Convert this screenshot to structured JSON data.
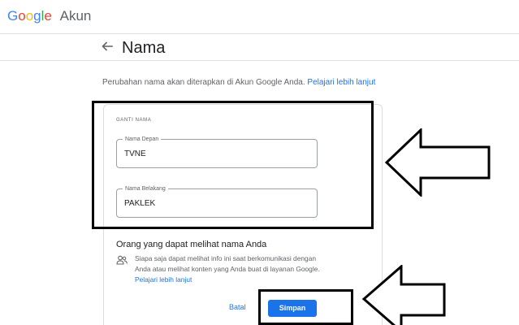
{
  "header": {
    "logo_letters": [
      "G",
      "o",
      "o",
      "g",
      "l",
      "e"
    ],
    "product": "Akun"
  },
  "title_bar": {
    "title": "Nama"
  },
  "description": {
    "text": "Perubahan nama akan diterapkan di Akun Google Anda.",
    "link": "Pelajari lebih lanjut"
  },
  "form": {
    "section_label": "GANTI NAMA",
    "first_name": {
      "label": "Nama Depan",
      "value": "TVNE"
    },
    "last_name": {
      "label": "Nama Belakang",
      "value": "PAKLEK"
    }
  },
  "visibility": {
    "title": "Orang yang dapat melihat nama Anda",
    "text": "Siapa saja dapat melihat info ini saat berkomunikasi dengan Anda atau melihat konten yang Anda buat di layanan Google.",
    "link": "Pelajari lebih lanjut"
  },
  "actions": {
    "cancel_label": "Batal",
    "save_label": "Simpan"
  },
  "colors": {
    "accent": "#1a73e8",
    "google_blue": "#4285f4",
    "google_red": "#ea4335",
    "google_yellow": "#fbbc05",
    "google_green": "#34a853"
  },
  "icons": [
    "back-arrow-icon",
    "people-icon",
    "annotation-arrow"
  ]
}
